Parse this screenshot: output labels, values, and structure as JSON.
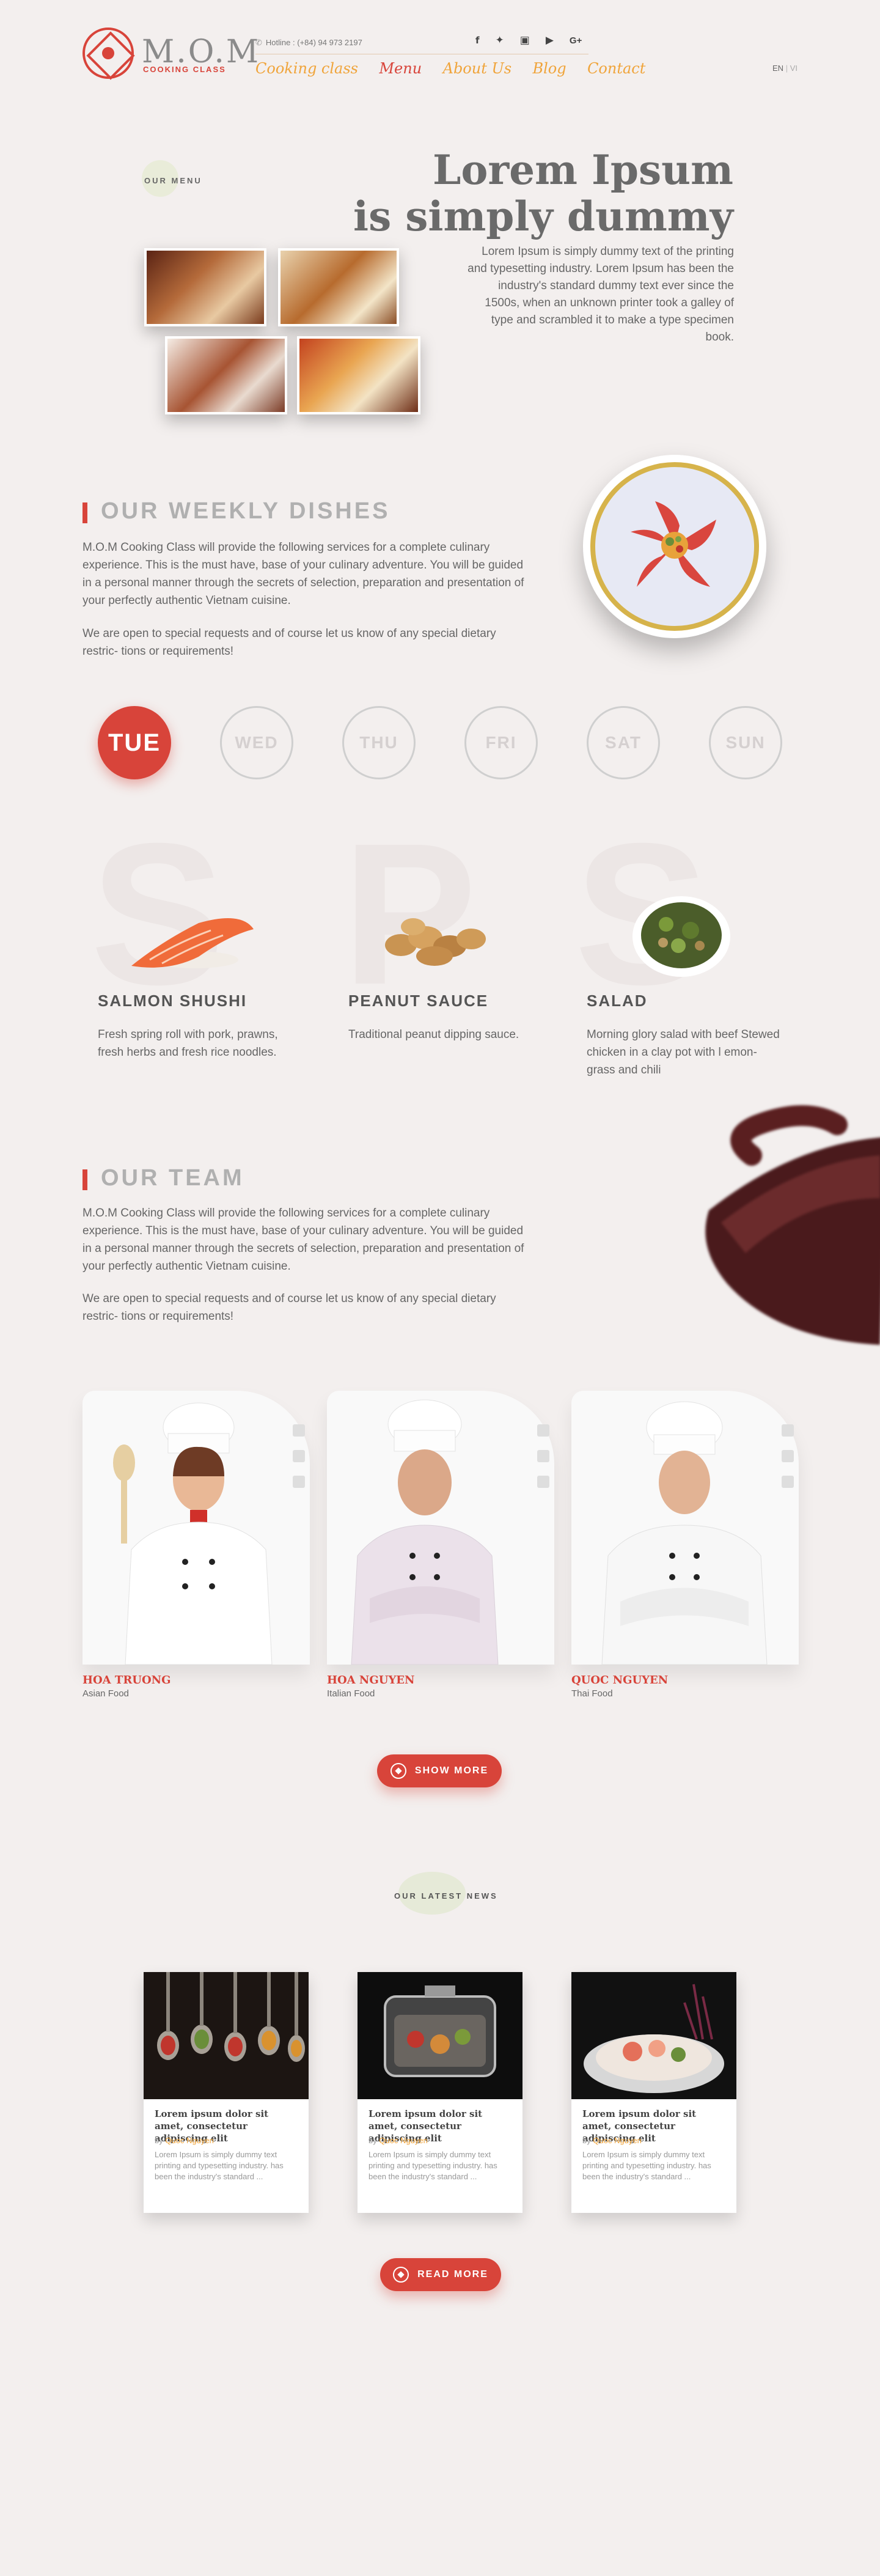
{
  "brand": {
    "name": "M.O.M",
    "tagline": "COOKING CLASS"
  },
  "header": {
    "hotline": "Hotline : (+84) 94 973 2197",
    "social": [
      "f",
      "t",
      "ig",
      "yt",
      "G+"
    ],
    "nav": [
      "Cooking class",
      "Menu",
      "About Us",
      "Blog",
      "Contact"
    ],
    "active_nav": "Menu",
    "lang": {
      "en": "EN",
      "sep": "|",
      "vi": "VI"
    }
  },
  "hero": {
    "label": "OUR MENU",
    "title_line1": "Lorem Ipsum",
    "title_line2": "is simply dummy",
    "description": "Lorem Ipsum is simply dummy text of the printing and typesetting industry. Lorem Ipsum has been the industry's standard dummy text ever since the 1500s, when an unknown printer took a galley of type and scrambled it to make a type specimen book."
  },
  "weekly": {
    "title": "OUR WEEKLY DISHES",
    "para1": "M.O.M Cooking Class will provide the following services for a complete culinary experience. This is the must have, base of your culinary adventure. You will be guided in a personal manner through the secrets of selection, preparation and presentation of your perfectly authentic Vietnam cuisine.",
    "para2": "We are open to special requests and of course let us know of any special dietary restric- tions or requirements!",
    "days": [
      "TUE",
      "WED",
      "THU",
      "FRI",
      "SAT",
      "SUN"
    ],
    "active_day": "TUE",
    "dishes": [
      {
        "letter": "S",
        "name": "SALMON SHUSHI",
        "desc": "Fresh spring roll with pork, prawns, fresh herbs and fresh rice noodles."
      },
      {
        "letter": "P",
        "name": "PEANUT SAUCE",
        "desc": "Traditional peanut dipping sauce."
      },
      {
        "letter": "S",
        "name": "SALAD",
        "desc": "Morning glory salad with beef Stewed chicken in a clay pot with l emon- grass and chili"
      }
    ]
  },
  "team": {
    "title": "OUR TEAM",
    "para1": "M.O.M Cooking Class will provide the following services for a complete culinary experience. This is the must have, base of your culinary adventure. You will be guided in a personal manner through the secrets of selection, preparation and presentation of your perfectly authentic Vietnam cuisine.",
    "para2": "We are open to special requests and of course let us know of any special dietary restric- tions or requirements!",
    "chefs": [
      {
        "name": "HOA TRUONG",
        "role": "Asian Food"
      },
      {
        "name": "HOA NGUYEN",
        "role": "Italian Food"
      },
      {
        "name": "QUOC NGUYEN",
        "role": "Thai Food"
      }
    ],
    "show_more": "SHOW MORE"
  },
  "news": {
    "title": "OUR LATEST NEWS",
    "items": [
      {
        "title": "Lorem ipsum dolor sit amet, consectetur adipiscing elit",
        "by": "by",
        "author": "Quoc Nguyen",
        "excerpt": "Lorem Ipsum is simply dummy text printing and typesetting industry. has been the industry's standard ..."
      },
      {
        "title": "Lorem ipsum dolor sit amet, consectetur adipiscing elit",
        "by": "by",
        "author": "Quoc Nguyen",
        "excerpt": "Lorem Ipsum is simply dummy text printing and typesetting industry. has been the industry's standard ..."
      },
      {
        "title": "Lorem ipsum dolor sit amet, consectetur adipiscing elit",
        "by": "by",
        "author": "Quoc Nguyen",
        "excerpt": "Lorem Ipsum is simply dummy text printing and typesetting industry. has been the industry's standard ..."
      }
    ],
    "read_more": "READ MORE"
  },
  "colors": {
    "accent": "#d8443a",
    "nav_gold": "#f0a43a",
    "background": "#f3efee"
  }
}
